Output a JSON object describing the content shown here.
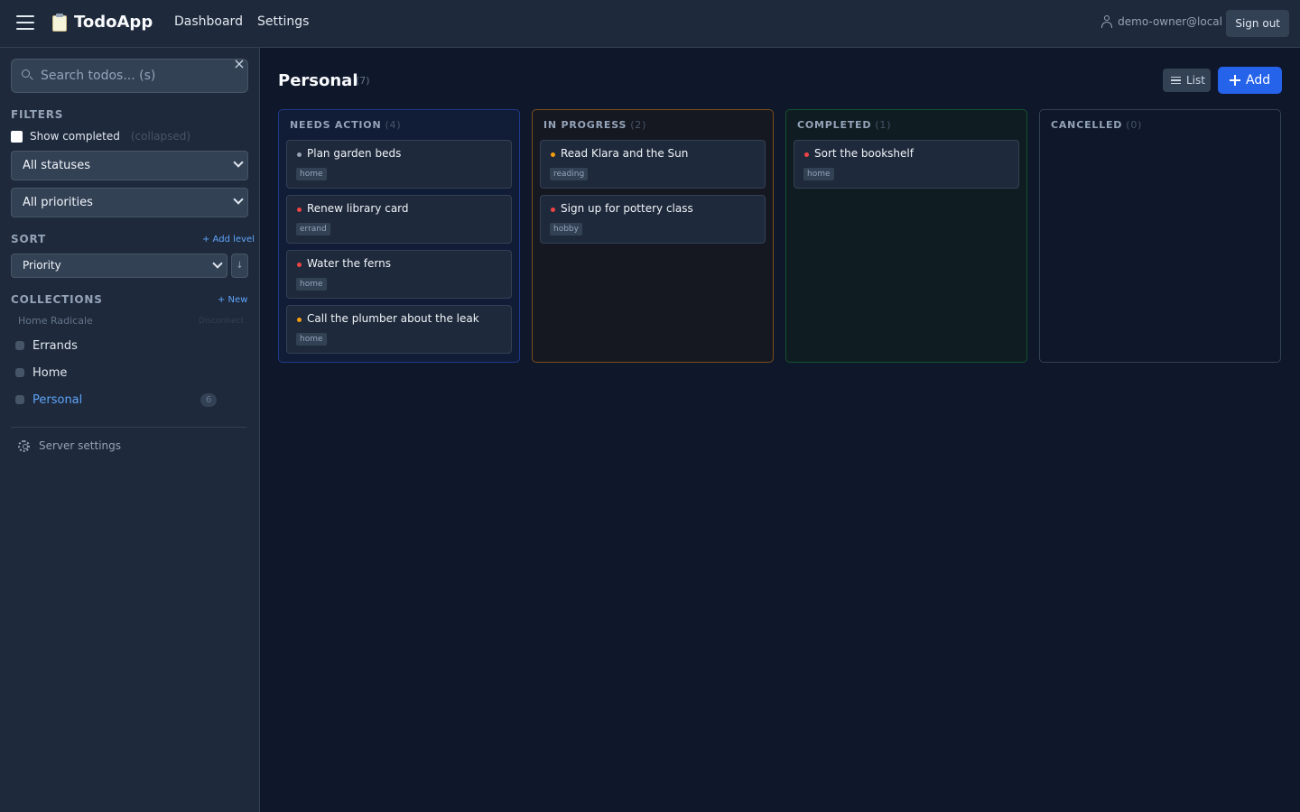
{
  "app": {
    "title": "TodoApp"
  },
  "nav": {
    "dashboard": "Dashboard",
    "settings": "Settings"
  },
  "user": {
    "email": "demo-owner@local",
    "signout_label": "Sign out"
  },
  "search": {
    "placeholder": "Search todos... (s)",
    "value": ""
  },
  "filters": {
    "label": "FILTERS",
    "show_completed_label": "Show completed",
    "show_completed_note": "(collapsed)",
    "show_completed": false,
    "status_select": "All statuses",
    "priority_select": "All priorities"
  },
  "sort": {
    "label": "SORT",
    "add_level": "+ Add level",
    "field": "Priority",
    "direction": "↓"
  },
  "collections": {
    "label": "COLLECTIONS",
    "new_label": "+ New",
    "source": "Home Radicale",
    "disconnect": "Disconnect",
    "items": [
      {
        "name": "Errands",
        "count": ""
      },
      {
        "name": "Home",
        "count": ""
      },
      {
        "name": "Personal",
        "count": "6"
      }
    ]
  },
  "server_settings": "Server settings",
  "main": {
    "title": "Personal",
    "count": "(7)",
    "list_button": "List",
    "add_button": "Add"
  },
  "columns": [
    {
      "title": "NEEDS ACTION",
      "count": "(4)",
      "cards": [
        {
          "title": "Plan garden beds",
          "tag": "home",
          "priority_color": "#94a3b8"
        },
        {
          "title": "Renew library card",
          "tag": "errand",
          "priority_color": "#ef4444"
        },
        {
          "title": "Water the ferns",
          "tag": "home",
          "priority_color": "#ef4444"
        },
        {
          "title": "Call the plumber about the leak",
          "tag": "home",
          "priority_color": "#f59e0b"
        }
      ]
    },
    {
      "title": "IN PROGRESS",
      "count": "(2)",
      "cards": [
        {
          "title": "Read Klara and the Sun",
          "tag": "reading",
          "priority_color": "#f59e0b"
        },
        {
          "title": "Sign up for pottery class",
          "tag": "hobby",
          "priority_color": "#ef4444"
        }
      ]
    },
    {
      "title": "COMPLETED",
      "count": "(1)",
      "cards": [
        {
          "title": "Sort the bookshelf",
          "tag": "home",
          "priority_color": "#ef4444"
        }
      ]
    },
    {
      "title": "CANCELLED",
      "count": "(0)",
      "cards": []
    }
  ],
  "colors": {
    "accent": "#2563eb",
    "link": "#60a5fa",
    "background": "#0f172a",
    "panel": "#1e293b"
  }
}
